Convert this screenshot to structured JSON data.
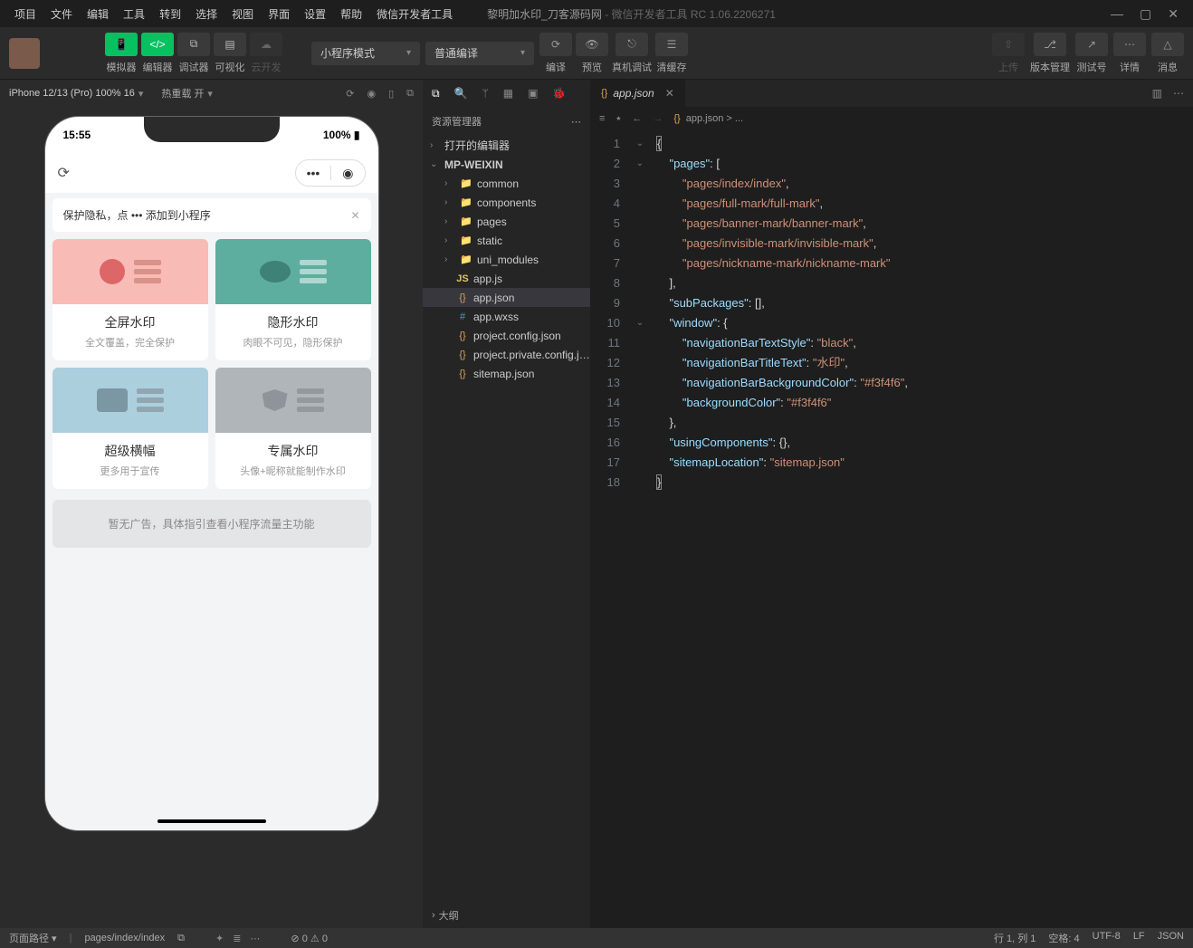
{
  "menu": [
    "项目",
    "文件",
    "编辑",
    "工具",
    "转到",
    "选择",
    "视图",
    "界面",
    "设置",
    "帮助",
    "微信开发者工具"
  ],
  "title_project": "黎明加水印_刀客源码网",
  "title_app": " - 微信开发者工具 RC 1.06.2206271",
  "toolbar_main": {
    "sim": "模拟器",
    "ed": "编辑器",
    "dbg": "调试器",
    "vis": "可视化",
    "cloud": "云开发"
  },
  "mode_select": "小程序模式",
  "compile_select": "普通编译",
  "center_tools": {
    "compile": "编译",
    "preview": "预览",
    "remote": "真机调试",
    "cache": "清缓存"
  },
  "right_tools": {
    "upload": "上传",
    "version": "版本管理",
    "testid": "测试号",
    "detail": "详情",
    "msg": "消息"
  },
  "sim": {
    "device": "iPhone 12/13 (Pro) 100% 16",
    "reload": "热重载 开",
    "time": "15:55",
    "battery": "100%"
  },
  "phone": {
    "hint": "保护隐私，点 ••• 添加到小程序",
    "cards": [
      {
        "title": "全屏水印",
        "sub": "全文覆盖，完全保护"
      },
      {
        "title": "隐形水印",
        "sub": "肉眼不可见，隐形保护"
      },
      {
        "title": "超级横幅",
        "sub": "更多用于宣传"
      },
      {
        "title": "专属水印",
        "sub": "头像+昵称就能制作水印"
      }
    ],
    "ad": "暂无广告，具体指引查看小程序流量主功能"
  },
  "explorer": {
    "title": "资源管理器",
    "sections": {
      "opened": "打开的编辑器",
      "root": "MP-WEIXIN",
      "outline": "大纲"
    },
    "tree": [
      "common",
      "components",
      "pages",
      "static",
      "uni_modules",
      "app.js",
      "app.json",
      "app.wxss",
      "project.config.json",
      "project.private.config.js...",
      "sitemap.json"
    ]
  },
  "editor": {
    "tab": "app.json",
    "crumb": "app.json > ...",
    "code": {
      "pages_key": "pages",
      "pages": [
        "pages/index/index",
        "pages/full-mark/full-mark",
        "pages/banner-mark/banner-mark",
        "pages/invisible-mark/invisible-mark",
        "pages/nickname-mark/nickname-mark"
      ],
      "subpkg_key": "subPackages",
      "window_key": "window",
      "win": {
        "navTxtStyleK": "navigationBarTextStyle",
        "navTxtStyleV": "black",
        "navTitleK": "navigationBarTitleText",
        "navTitleV": "水印",
        "navBgK": "navigationBarBackgroundColor",
        "navBgV": "#f3f4f6",
        "bgK": "backgroundColor",
        "bgV": "#f3f4f6"
      },
      "usingK": "usingComponents",
      "sitemapK": "sitemapLocation",
      "sitemapV": "sitemap.json"
    }
  },
  "statusbar": {
    "path_label": "页面路径",
    "path": "pages/index/index",
    "errs": "0",
    "warns": "0",
    "ln": "行 1, 列 1",
    "spaces": "空格: 4",
    "enc": "UTF-8",
    "eol": "LF",
    "lang": "JSON"
  }
}
